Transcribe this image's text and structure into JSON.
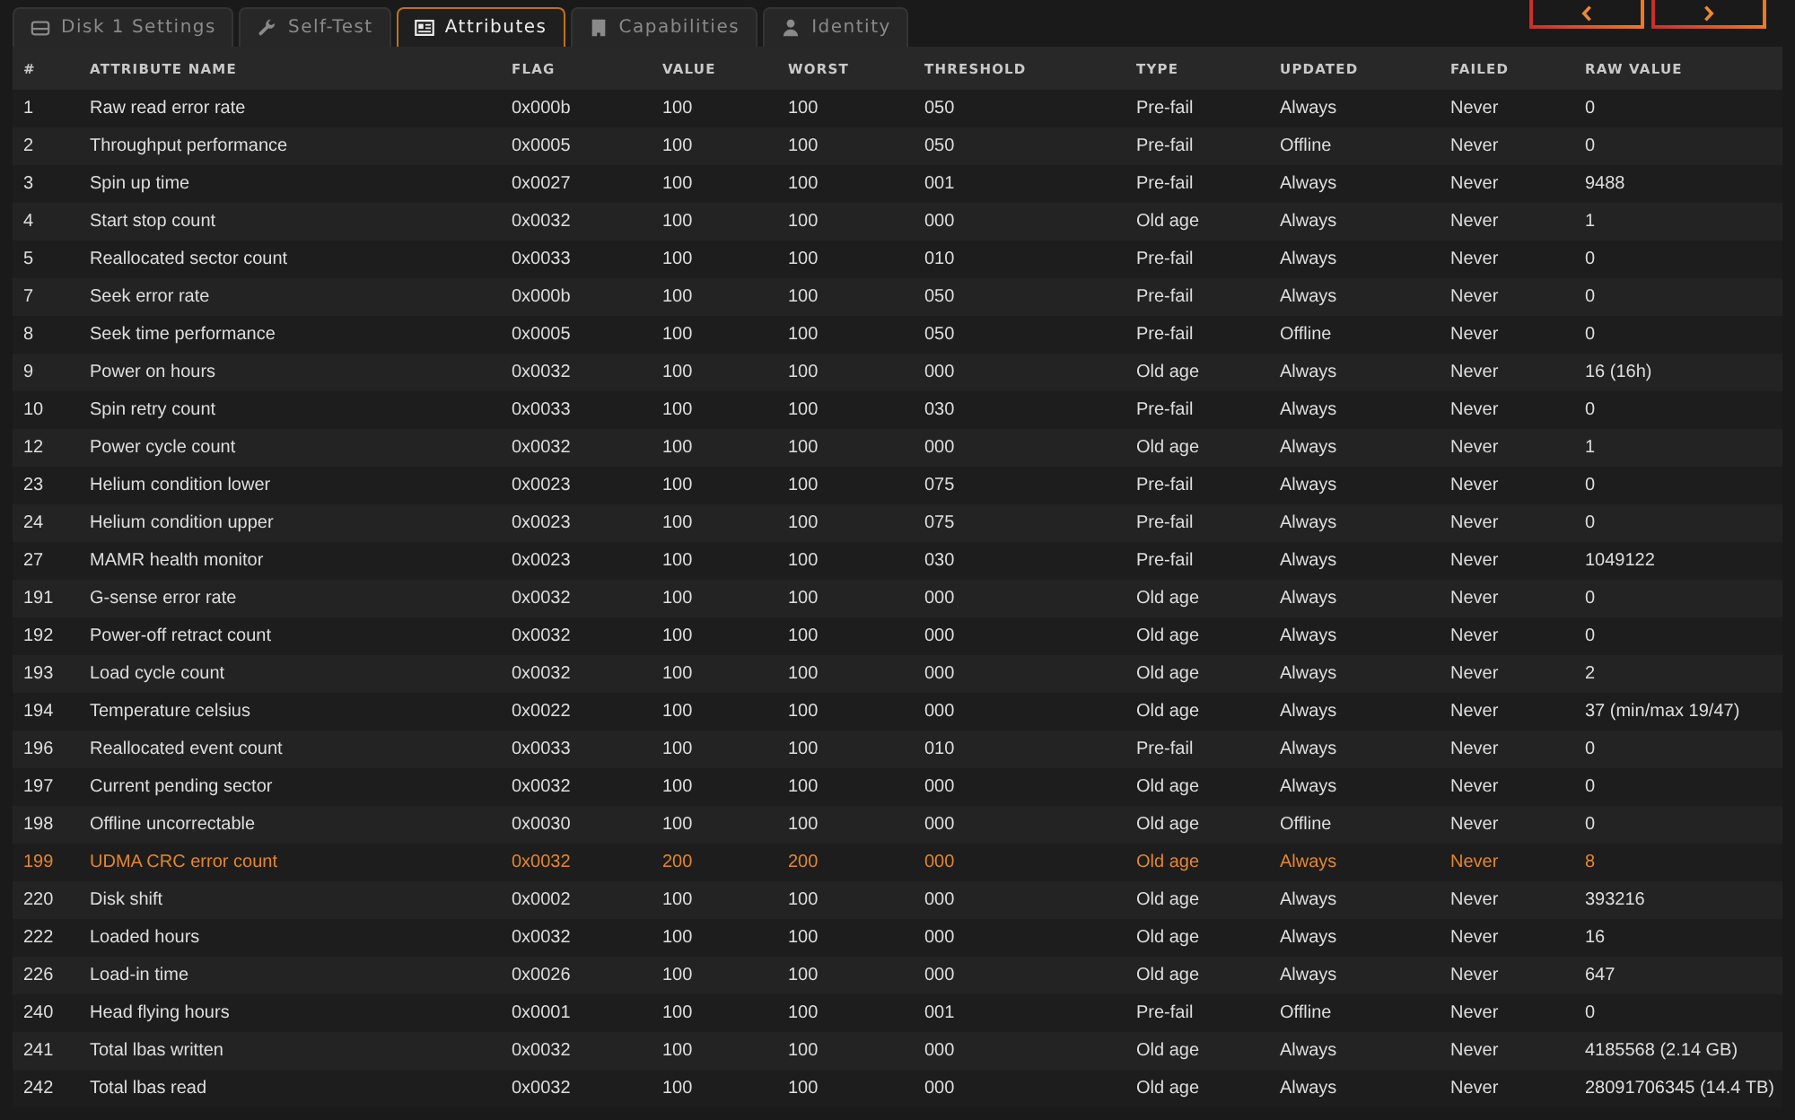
{
  "tabs": [
    {
      "label": "Disk 1 Settings",
      "selected": false
    },
    {
      "label": "Self-Test",
      "selected": false
    },
    {
      "label": "Attributes",
      "selected": true
    },
    {
      "label": "Capabilities",
      "selected": false
    },
    {
      "label": "Identity",
      "selected": false
    }
  ],
  "table": {
    "columns": [
      "#",
      "ATTRIBUTE NAME",
      "FLAG",
      "VALUE",
      "WORST",
      "THRESHOLD",
      "TYPE",
      "UPDATED",
      "FAILED",
      "RAW VALUE"
    ],
    "rows": [
      {
        "cells": [
          "1",
          "Raw read error rate",
          "0x000b",
          "100",
          "100",
          "050",
          "Pre-fail",
          "Always",
          "Never",
          "0"
        ],
        "warning": false
      },
      {
        "cells": [
          "2",
          "Throughput performance",
          "0x0005",
          "100",
          "100",
          "050",
          "Pre-fail",
          "Offline",
          "Never",
          "0"
        ],
        "warning": false
      },
      {
        "cells": [
          "3",
          "Spin up time",
          "0x0027",
          "100",
          "100",
          "001",
          "Pre-fail",
          "Always",
          "Never",
          "9488"
        ],
        "warning": false
      },
      {
        "cells": [
          "4",
          "Start stop count",
          "0x0032",
          "100",
          "100",
          "000",
          "Old age",
          "Always",
          "Never",
          "1"
        ],
        "warning": false
      },
      {
        "cells": [
          "5",
          "Reallocated sector count",
          "0x0033",
          "100",
          "100",
          "010",
          "Pre-fail",
          "Always",
          "Never",
          "0"
        ],
        "warning": false
      },
      {
        "cells": [
          "7",
          "Seek error rate",
          "0x000b",
          "100",
          "100",
          "050",
          "Pre-fail",
          "Always",
          "Never",
          "0"
        ],
        "warning": false
      },
      {
        "cells": [
          "8",
          "Seek time performance",
          "0x0005",
          "100",
          "100",
          "050",
          "Pre-fail",
          "Offline",
          "Never",
          "0"
        ],
        "warning": false
      },
      {
        "cells": [
          "9",
          "Power on hours",
          "0x0032",
          "100",
          "100",
          "000",
          "Old age",
          "Always",
          "Never",
          "16 (16h)"
        ],
        "warning": false
      },
      {
        "cells": [
          "10",
          "Spin retry count",
          "0x0033",
          "100",
          "100",
          "030",
          "Pre-fail",
          "Always",
          "Never",
          "0"
        ],
        "warning": false
      },
      {
        "cells": [
          "12",
          "Power cycle count",
          "0x0032",
          "100",
          "100",
          "000",
          "Old age",
          "Always",
          "Never",
          "1"
        ],
        "warning": false
      },
      {
        "cells": [
          "23",
          "Helium condition lower",
          "0x0023",
          "100",
          "100",
          "075",
          "Pre-fail",
          "Always",
          "Never",
          "0"
        ],
        "warning": false
      },
      {
        "cells": [
          "24",
          "Helium condition upper",
          "0x0023",
          "100",
          "100",
          "075",
          "Pre-fail",
          "Always",
          "Never",
          "0"
        ],
        "warning": false
      },
      {
        "cells": [
          "27",
          "MAMR health monitor",
          "0x0023",
          "100",
          "100",
          "030",
          "Pre-fail",
          "Always",
          "Never",
          "1049122"
        ],
        "warning": false
      },
      {
        "cells": [
          "191",
          "G-sense error rate",
          "0x0032",
          "100",
          "100",
          "000",
          "Old age",
          "Always",
          "Never",
          "0"
        ],
        "warning": false
      },
      {
        "cells": [
          "192",
          "Power-off retract count",
          "0x0032",
          "100",
          "100",
          "000",
          "Old age",
          "Always",
          "Never",
          "0"
        ],
        "warning": false
      },
      {
        "cells": [
          "193",
          "Load cycle count",
          "0x0032",
          "100",
          "100",
          "000",
          "Old age",
          "Always",
          "Never",
          "2"
        ],
        "warning": false
      },
      {
        "cells": [
          "194",
          "Temperature celsius",
          "0x0022",
          "100",
          "100",
          "000",
          "Old age",
          "Always",
          "Never",
          "37 (min/max 19/47)"
        ],
        "warning": false
      },
      {
        "cells": [
          "196",
          "Reallocated event count",
          "0x0033",
          "100",
          "100",
          "010",
          "Pre-fail",
          "Always",
          "Never",
          "0"
        ],
        "warning": false
      },
      {
        "cells": [
          "197",
          "Current pending sector",
          "0x0032",
          "100",
          "100",
          "000",
          "Old age",
          "Always",
          "Never",
          "0"
        ],
        "warning": false
      },
      {
        "cells": [
          "198",
          "Offline uncorrectable",
          "0x0030",
          "100",
          "100",
          "000",
          "Old age",
          "Offline",
          "Never",
          "0"
        ],
        "warning": false
      },
      {
        "cells": [
          "199",
          "UDMA CRC error count",
          "0x0032",
          "200",
          "200",
          "000",
          "Old age",
          "Always",
          "Never",
          "8"
        ],
        "warning": true
      },
      {
        "cells": [
          "220",
          "Disk shift",
          "0x0002",
          "100",
          "100",
          "000",
          "Old age",
          "Always",
          "Never",
          "393216"
        ],
        "warning": false
      },
      {
        "cells": [
          "222",
          "Loaded hours",
          "0x0032",
          "100",
          "100",
          "000",
          "Old age",
          "Always",
          "Never",
          "16"
        ],
        "warning": false
      },
      {
        "cells": [
          "226",
          "Load-in time",
          "0x0026",
          "100",
          "100",
          "000",
          "Old age",
          "Always",
          "Never",
          "647"
        ],
        "warning": false
      },
      {
        "cells": [
          "240",
          "Head flying hours",
          "0x0001",
          "100",
          "100",
          "001",
          "Pre-fail",
          "Offline",
          "Never",
          "0"
        ],
        "warning": false
      },
      {
        "cells": [
          "241",
          "Total lbas written",
          "0x0032",
          "100",
          "100",
          "000",
          "Old age",
          "Always",
          "Never",
          "4185568 (2.14 GB)"
        ],
        "warning": false
      },
      {
        "cells": [
          "242",
          "Total lbas read",
          "0x0032",
          "100",
          "100",
          "000",
          "Old age",
          "Always",
          "Never",
          "28091706345 (14.4 TB)"
        ],
        "warning": false
      }
    ]
  }
}
